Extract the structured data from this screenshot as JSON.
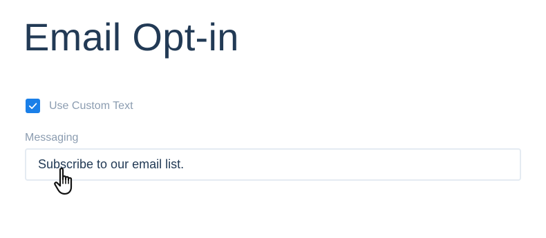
{
  "page": {
    "title": "Email Opt-in"
  },
  "custom_text": {
    "checked": true,
    "label": "Use Custom Text"
  },
  "messaging": {
    "label": "Messaging",
    "value": "Subscribe to our email list."
  },
  "colors": {
    "accent": "#1a7fe8",
    "title": "#223a55",
    "muted_label": "#8b9cb0",
    "input_border": "#e4ebf2"
  },
  "icons": {
    "checkbox": "checkmark-icon",
    "pointer": "hand-pointer-cursor-icon"
  }
}
